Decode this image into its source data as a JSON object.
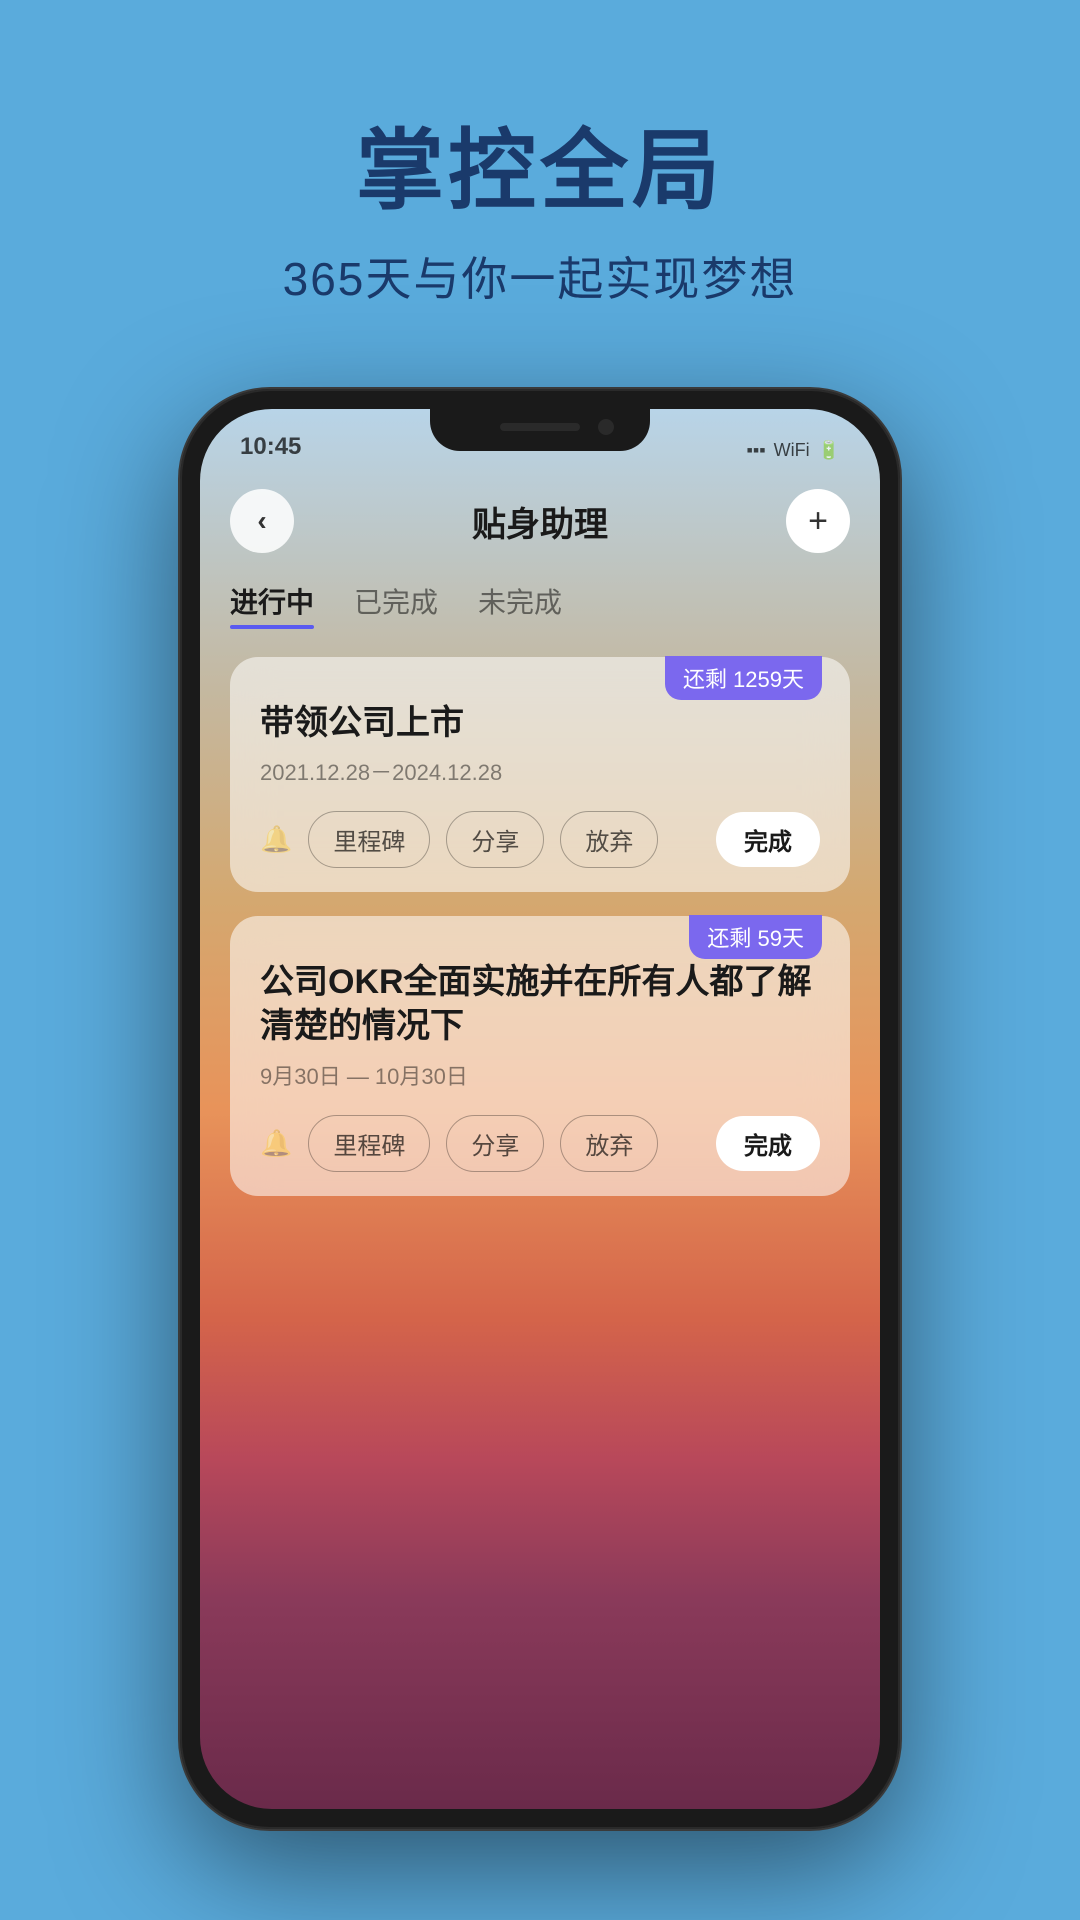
{
  "page": {
    "title": "掌控全局",
    "subtitle": "365天与你一起实现梦想"
  },
  "phone": {
    "status_time": "10:45",
    "nav_title": "贴身助理",
    "nav_back": "‹",
    "nav_add": "+",
    "tabs": [
      {
        "label": "进行中",
        "active": true
      },
      {
        "label": "已完成",
        "active": false
      },
      {
        "label": "未完成",
        "active": false
      }
    ],
    "goals": [
      {
        "badge": "还剩 1259天",
        "title": "带领公司上市",
        "date": "2021.12.28－2024.12.28",
        "actions": [
          "里程碑",
          "分享",
          "放弃"
        ],
        "complete": "完成"
      },
      {
        "badge": "还剩 59天",
        "title": "公司OKR全面实施并在所有人都了解清楚的情况下",
        "date": "9月30日 — 10月30日",
        "actions": [
          "里程碑",
          "分享",
          "放弃"
        ],
        "complete": "完成"
      }
    ]
  }
}
